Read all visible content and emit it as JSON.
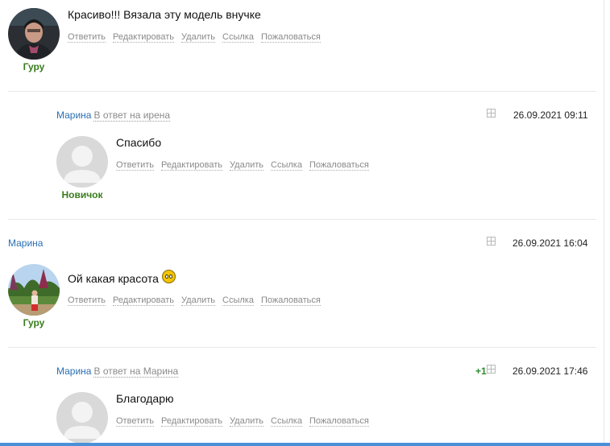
{
  "actions": [
    "Ответить",
    "Редактировать",
    "Удалить",
    "Ссылка",
    "Пожаловаться"
  ],
  "comments": [
    {
      "author": "",
      "reply_to": "",
      "date": "",
      "rank": "Гуру",
      "text": "Красиво!!! Вязала эту модель внучке",
      "plus": ""
    },
    {
      "author": "Марина",
      "reply_to": "В ответ на ирена",
      "date": "26.09.2021 09:11",
      "rank": "Новичок",
      "text": "Спасибо",
      "plus": ""
    },
    {
      "author": "Марина",
      "reply_to": "",
      "date": "26.09.2021 16:04",
      "rank": "Гуру",
      "text": "Ой какая красота",
      "plus": ""
    },
    {
      "author": "Марина",
      "reply_to": "В ответ на Марина",
      "date": "26.09.2021 17:46",
      "rank": "",
      "text": "Благодарю",
      "plus": "+1"
    }
  ],
  "icons": {
    "expand": "expand-plus-icon",
    "smiley": "smiley-icon"
  },
  "colors": {
    "author": "#2a6fb3",
    "rank": "#3a7d1e",
    "plus": "#2e8b2e",
    "accent_bar": "#4a90d9"
  }
}
